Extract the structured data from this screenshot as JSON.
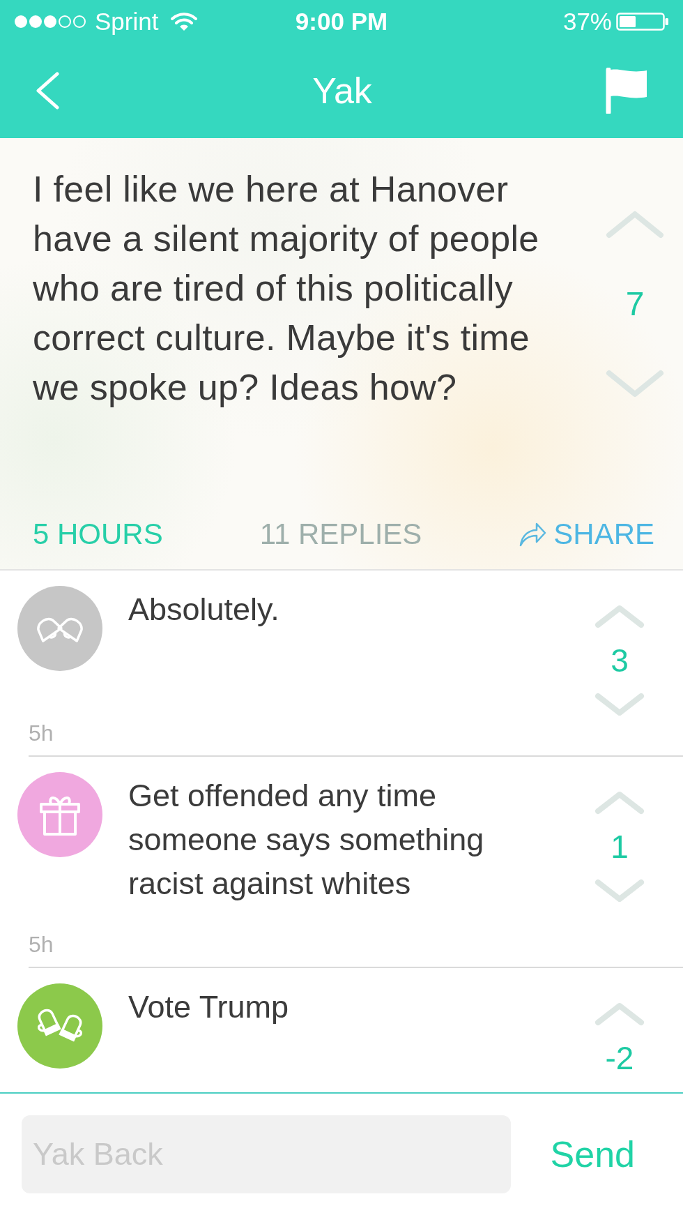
{
  "status_bar": {
    "carrier": "Sprint",
    "time": "9:00 PM",
    "battery": "37%"
  },
  "nav": {
    "title": "Yak"
  },
  "post": {
    "text": "I feel like we here at Hanover have a silent majority of people who are tired of this politically correct culture. Maybe it's time we spoke up? Ideas how?",
    "votes": "7",
    "age": "5 HOURS",
    "replies": "11 REPLIES",
    "share": "SHARE"
  },
  "replies": [
    {
      "avatar": {
        "kind": "bells",
        "color": "#c6c6c6"
      },
      "text": "Absolutely.",
      "votes": "3",
      "age": "5h"
    },
    {
      "avatar": {
        "kind": "gift",
        "color": "#f0a8df"
      },
      "text": "Get offended any time someone says something racist against whites",
      "votes": "1",
      "age": "5h"
    },
    {
      "avatar": {
        "kind": "mittens",
        "color": "#8cc94b"
      },
      "text": "Vote Trump",
      "votes": "-2"
    }
  ],
  "composer": {
    "placeholder": "Yak Back",
    "send": "Send"
  }
}
